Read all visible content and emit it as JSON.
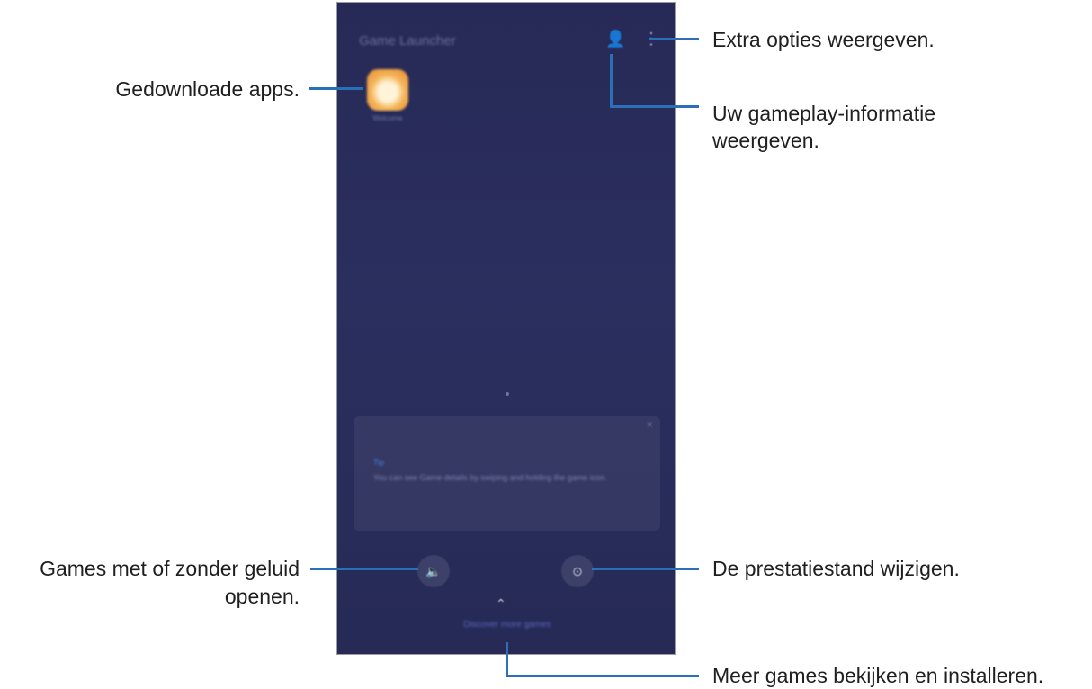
{
  "phone": {
    "app_title": "Game Launcher",
    "profile_icon": "👤",
    "more_icon": "⋮",
    "game_app_label": "Welcome",
    "tip_close": "✕",
    "tip_label": "Tip",
    "tip_text": "You can see Game details by swiping and holding the game icon.",
    "sound_icon": "🔈",
    "performance_icon": "⊙",
    "chevron_icon": "⌃",
    "more_games_label": "Discover more games"
  },
  "callouts": {
    "extra_options": "Extra opties weergeven.",
    "gameplay_info_line1": "Uw gameplay-informatie",
    "gameplay_info_line2": "weergeven.",
    "downloaded_apps": "Gedownloade apps.",
    "sound_line1": "Games met of zonder geluid",
    "sound_line2": "openen.",
    "performance": "De prestatiestand wijzigen.",
    "more_games": "Meer games bekijken en installeren."
  },
  "colors": {
    "phone_background": "#2a2d5c",
    "leader_line": "#2a6fb8",
    "callout_text": "#1f1f1f"
  }
}
